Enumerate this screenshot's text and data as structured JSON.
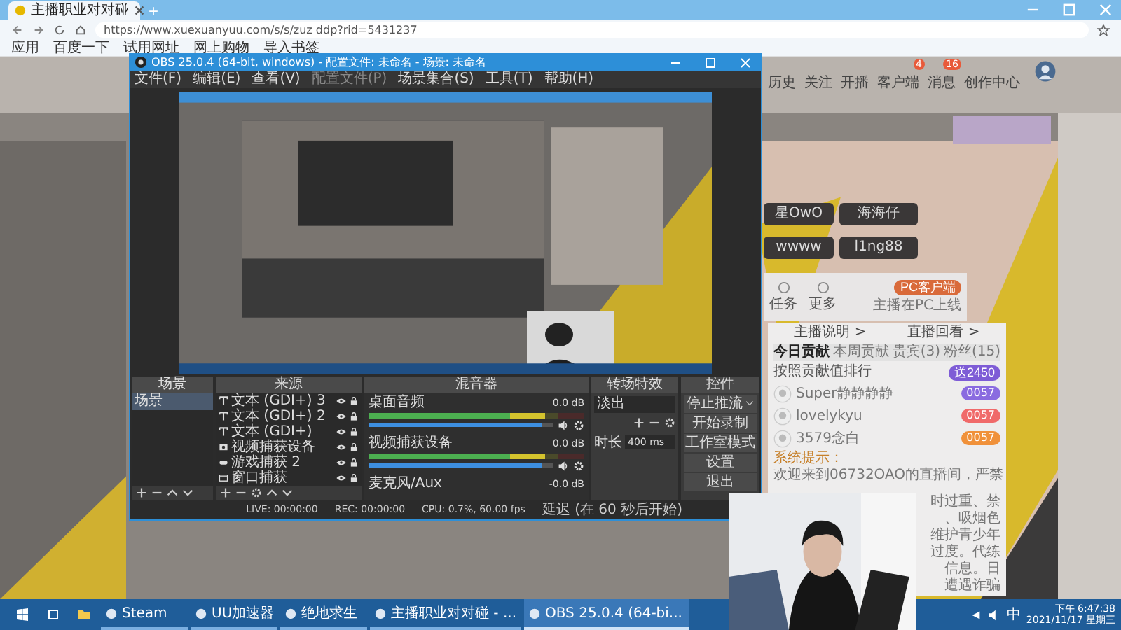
{
  "browser": {
    "tab": {
      "title": "主播职业对对碰"
    },
    "new_tab": "+",
    "address": "https://www.xuexuanyuu.com/s/s/zuz ddp?rid=5431237",
    "bookmarks": [
      {
        "label": "应用"
      },
      {
        "label": "百度一下"
      },
      {
        "label": "试用网址"
      },
      {
        "label": "网上购物"
      },
      {
        "label": "导入书签"
      }
    ]
  },
  "page": {
    "nav": [
      {
        "label": "历史"
      },
      {
        "label": "关注"
      },
      {
        "label": "开播"
      },
      {
        "label": "客户端",
        "badge": "4"
      },
      {
        "label": "消息",
        "badge": "16"
      },
      {
        "label": "创作中心"
      }
    ],
    "name_tags": [
      "星OwO",
      "海海仔",
      "wwww",
      "l1ng88"
    ],
    "actions": [
      {
        "label": "任务"
      },
      {
        "label": "更多"
      }
    ],
    "client_button": "PC客户端",
    "client_note": "主播在PC上线",
    "links": [
      "主播说明 >",
      "直播回看 >"
    ],
    "rank_tabs": [
      {
        "label": "今日贡献",
        "selected": true
      },
      {
        "label": "本周贡献",
        "selected": false
      },
      {
        "label": "贵宾(3)",
        "selected": false
      },
      {
        "label": "粉丝(15)",
        "selected": false
      }
    ],
    "rank_note": "按照贡献值排行",
    "gift_button": "送2450",
    "ranks": [
      {
        "name": "Super静静静静",
        "score": "0057",
        "color": "#8a6be0"
      },
      {
        "name": "lovelykyu",
        "score": "0057",
        "color": "#f06a6a"
      },
      {
        "name": "3579念白",
        "score": "0057",
        "color": "#f0913a"
      }
    ],
    "notice_label": "系统提示：",
    "notice": "欢迎来到06732OAO的直播间，严禁",
    "notice_lines": [
      "时过重、禁",
      "、吸烟色",
      "维护青少年",
      "过度。代练",
      "信息。日",
      "遭遇诈骗"
    ]
  },
  "obs": {
    "title": "OBS 25.0.4 (64-bit, windows) - 配置文件: 未命名 - 场景: 未命名",
    "menu": [
      "文件(F)",
      "编辑(E)",
      "查看(V)",
      "配置文件(P)",
      "场景集合(S)",
      "工具(T)",
      "帮助(H)"
    ],
    "docks": {
      "scenes": "场景",
      "sources": "来源",
      "mixer": "混音器",
      "transitions": "转场特效",
      "controls": "控件"
    },
    "scenes": [
      {
        "label": "场景",
        "selected": true
      }
    ],
    "sources": [
      {
        "label": "文本 (GDI+) 3",
        "kind": "text",
        "visible": true
      },
      {
        "label": "文本 (GDI+) 2",
        "kind": "text",
        "visible": true
      },
      {
        "label": "文本 (GDI+)",
        "kind": "text",
        "visible": true
      },
      {
        "label": "视频捕获设备",
        "kind": "camera",
        "visible": true
      },
      {
        "label": "游戏捕获 2",
        "kind": "game",
        "visible": true
      },
      {
        "label": "窗口捕获",
        "kind": "window",
        "visible": true
      }
    ],
    "mixer": [
      {
        "name": "桌面音频",
        "reading": "0.0 dB",
        "level": 0.94
      },
      {
        "name": "视频捕获设备",
        "reading": "0.0 dB",
        "level": 0.94
      },
      {
        "name": "麦克风/Aux",
        "reading": "-0.0 dB"
      }
    ],
    "transition": {
      "value": "淡出",
      "duration_label": "时长",
      "duration": "400 ms"
    },
    "controls": [
      {
        "label": "停止推流",
        "dropdown": true
      },
      {
        "label": "开始录制",
        "dropdown": false
      },
      {
        "label": "工作室模式",
        "dropdown": false
      },
      {
        "label": "设置",
        "dropdown": false
      },
      {
        "label": "退出",
        "dropdown": false
      }
    ],
    "status": [
      "LIVE: 00:00:00",
      "REC: 00:00:00",
      "CPU: 0.7%, 60.00 fps",
      "延迟 (在 60 秒后开始)"
    ]
  },
  "taskbar": {
    "apps": [
      {
        "label": "Steam",
        "selected": false
      },
      {
        "label": "UU加速器",
        "selected": false
      },
      {
        "label": "绝地求生",
        "selected": false
      },
      {
        "label": "主播职业对对碰 - ...",
        "selected": false
      },
      {
        "label": "OBS 25.0.4 (64-bi...",
        "selected": true
      }
    ],
    "ime": "中",
    "time": "下午 6:47:38",
    "date": "2021/11/17 星期三"
  }
}
